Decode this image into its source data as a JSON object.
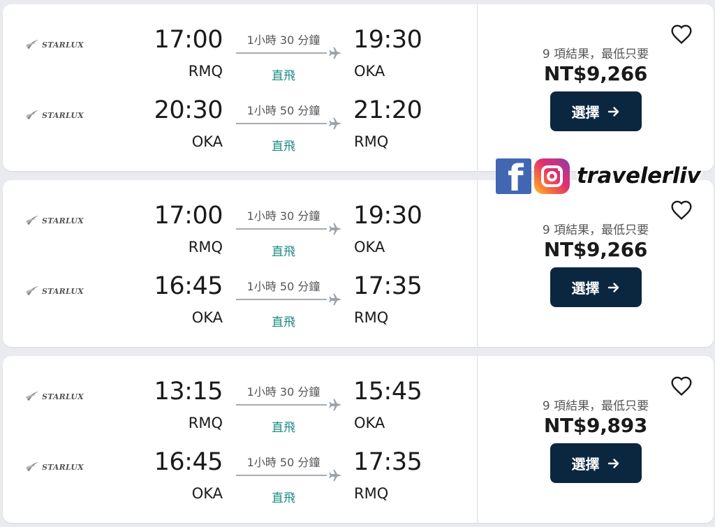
{
  "colors": {
    "button_bg": "#0b2740",
    "direct_text": "#1b8a84",
    "facebook": "#4267b2"
  },
  "results": [
    {
      "legs": [
        {
          "airline": "STARLUX",
          "dep_time": "17:00",
          "dep_code": "RMQ",
          "duration": "1小時 30 分鐘",
          "stops": "直飛",
          "arr_time": "19:30",
          "arr_code": "OKA"
        },
        {
          "airline": "STARLUX",
          "dep_time": "20:30",
          "dep_code": "OKA",
          "duration": "1小時 50 分鐘",
          "stops": "直飛",
          "arr_time": "21:20",
          "arr_code": "RMQ"
        }
      ],
      "results_text": "9 項結果，最低只要",
      "price": "NT$9,266",
      "select_label": "選擇"
    },
    {
      "legs": [
        {
          "airline": "STARLUX",
          "dep_time": "17:00",
          "dep_code": "RMQ",
          "duration": "1小時 30 分鐘",
          "stops": "直飛",
          "arr_time": "19:30",
          "arr_code": "OKA"
        },
        {
          "airline": "STARLUX",
          "dep_time": "16:45",
          "dep_code": "OKA",
          "duration": "1小時 50 分鐘",
          "stops": "直飛",
          "arr_time": "17:35",
          "arr_code": "RMQ"
        }
      ],
      "results_text": "9 項結果，最低只要",
      "price": "NT$9,266",
      "select_label": "選擇"
    },
    {
      "legs": [
        {
          "airline": "STARLUX",
          "dep_time": "13:15",
          "dep_code": "RMQ",
          "duration": "1小時 30 分鐘",
          "stops": "直飛",
          "arr_time": "15:45",
          "arr_code": "OKA"
        },
        {
          "airline": "STARLUX",
          "dep_time": "16:45",
          "dep_code": "OKA",
          "duration": "1小時 50 分鐘",
          "stops": "直飛",
          "arr_time": "17:35",
          "arr_code": "RMQ"
        }
      ],
      "results_text": "9 項結果，最低只要",
      "price": "NT$9,893",
      "select_label": "選擇"
    }
  ],
  "watermark": {
    "icons": [
      "facebook-icon",
      "instagram-icon"
    ],
    "text": "travelerliv"
  }
}
